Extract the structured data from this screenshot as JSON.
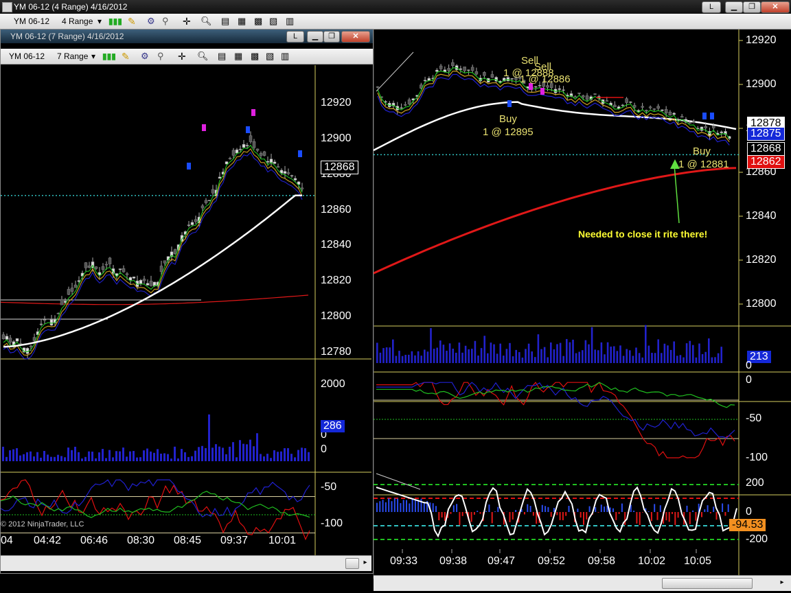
{
  "main_window": {
    "title": "YM 06-12 (4 Range)  4/16/2012",
    "toolbar": {
      "instrument": "YM 06-12",
      "interval": "4 Range"
    },
    "btn_link": "L",
    "price_axis": [
      "12920",
      "12900",
      "12880",
      "12860",
      "12840",
      "12820",
      "12800"
    ],
    "price_tags": [
      {
        "text": "12878",
        "bg": "#ffffff",
        "fg": "#000000"
      },
      {
        "text": "12875",
        "bg": "#1428d8",
        "fg": "#ffffff"
      },
      {
        "text": "12868",
        "bg": "#000000",
        "fg": "#ffffff"
      },
      {
        "text": "12862",
        "bg": "#e01010",
        "fg": "#ffffff"
      }
    ],
    "volume_tag": "213",
    "volume_axis": [
      "0"
    ],
    "stoch_axis": [
      "0",
      "-50",
      "-100"
    ],
    "cci_axis": [
      "200",
      "0",
      "-200"
    ],
    "cci_tag": "-94.53",
    "time_axis": [
      "09:33",
      "09:38",
      "09:47",
      "09:52",
      "09:58",
      "10:02",
      "10:05"
    ],
    "annotations": {
      "sell_label": "Sell",
      "sell_detail": "1 @ 12888",
      "sell2_label": "Sell",
      "sell2_detail": "1 @ 12886",
      "buy_label": "Buy",
      "buy_detail": "1 @ 12895",
      "buy2_label": "Buy",
      "buy2_detail": "1 @ 12881",
      "note": "Needed to close it rite there!"
    }
  },
  "second_window": {
    "title": "YM 06-12 (7 Range)  4/16/2012",
    "toolbar": {
      "instrument": "YM 06-12",
      "interval": "7 Range"
    },
    "btn_link": "L",
    "price_axis": [
      "12920",
      "12900",
      "12880",
      "12860",
      "12840",
      "12820",
      "12800",
      "12780"
    ],
    "price_tags": [
      {
        "text": "12868",
        "bg": "#000000",
        "fg": "#ffffff"
      }
    ],
    "volume_tag": "286",
    "volume_axis": [
      "2000",
      "0"
    ],
    "stoch_axis": [
      "0",
      "-50",
      "-100"
    ],
    "time_axis": [
      "04",
      "04:42",
      "06:46",
      "08:30",
      "08:45",
      "09:37",
      "10:01"
    ],
    "copyright": "© 2012 NinjaTrader, LLC"
  },
  "colors": {
    "ema_white": "#ffffff",
    "sma_red": "#e01818",
    "volume": "#2222cc",
    "stoch_fast": "#e01010",
    "stoch_slow": "#2020d0",
    "stoch_green": "#20c020",
    "trade_buy": "#1a4cff",
    "trade_sell": "#e020e0",
    "note": "#ffff33",
    "hline": "#30c0c0"
  },
  "chart_data": [
    {
      "type": "candlestick",
      "title": "YM 06-12 (4 Range)  4/16/2012",
      "x": [
        "09:33",
        "09:38",
        "09:47",
        "09:52",
        "09:58",
        "10:02",
        "10:05"
      ],
      "ylim": [
        12790,
        12925
      ],
      "series": [
        {
          "name": "close",
          "values": [
            12880,
            12905,
            12900,
            12890,
            12885,
            12880,
            12878
          ]
        }
      ],
      "current_price": 12868,
      "indicators": {
        "ema": 12875,
        "sma_red": 12862
      },
      "trades": [
        {
          "side": "Sell",
          "qty": 1,
          "price": 12888
        },
        {
          "side": "Sell",
          "qty": 1,
          "price": 12886
        },
        {
          "side": "Buy",
          "qty": 1,
          "price": 12895
        },
        {
          "side": "Buy",
          "qty": 1,
          "price": 12881
        }
      ],
      "volume_last": 213,
      "cci_last": -94.53
    },
    {
      "type": "candlestick",
      "title": "YM 06-12 (7 Range)  4/16/2012",
      "x": [
        "04",
        "04:42",
        "06:46",
        "08:30",
        "08:45",
        "09:37",
        "10:01"
      ],
      "ylim": [
        12770,
        12925
      ],
      "series": [
        {
          "name": "close",
          "values": [
            12785,
            12790,
            12830,
            12825,
            12860,
            12900,
            12870
          ]
        }
      ],
      "current_price": 12868,
      "volume_last": 286,
      "volume_ylim": [
        0,
        2000
      ]
    }
  ]
}
